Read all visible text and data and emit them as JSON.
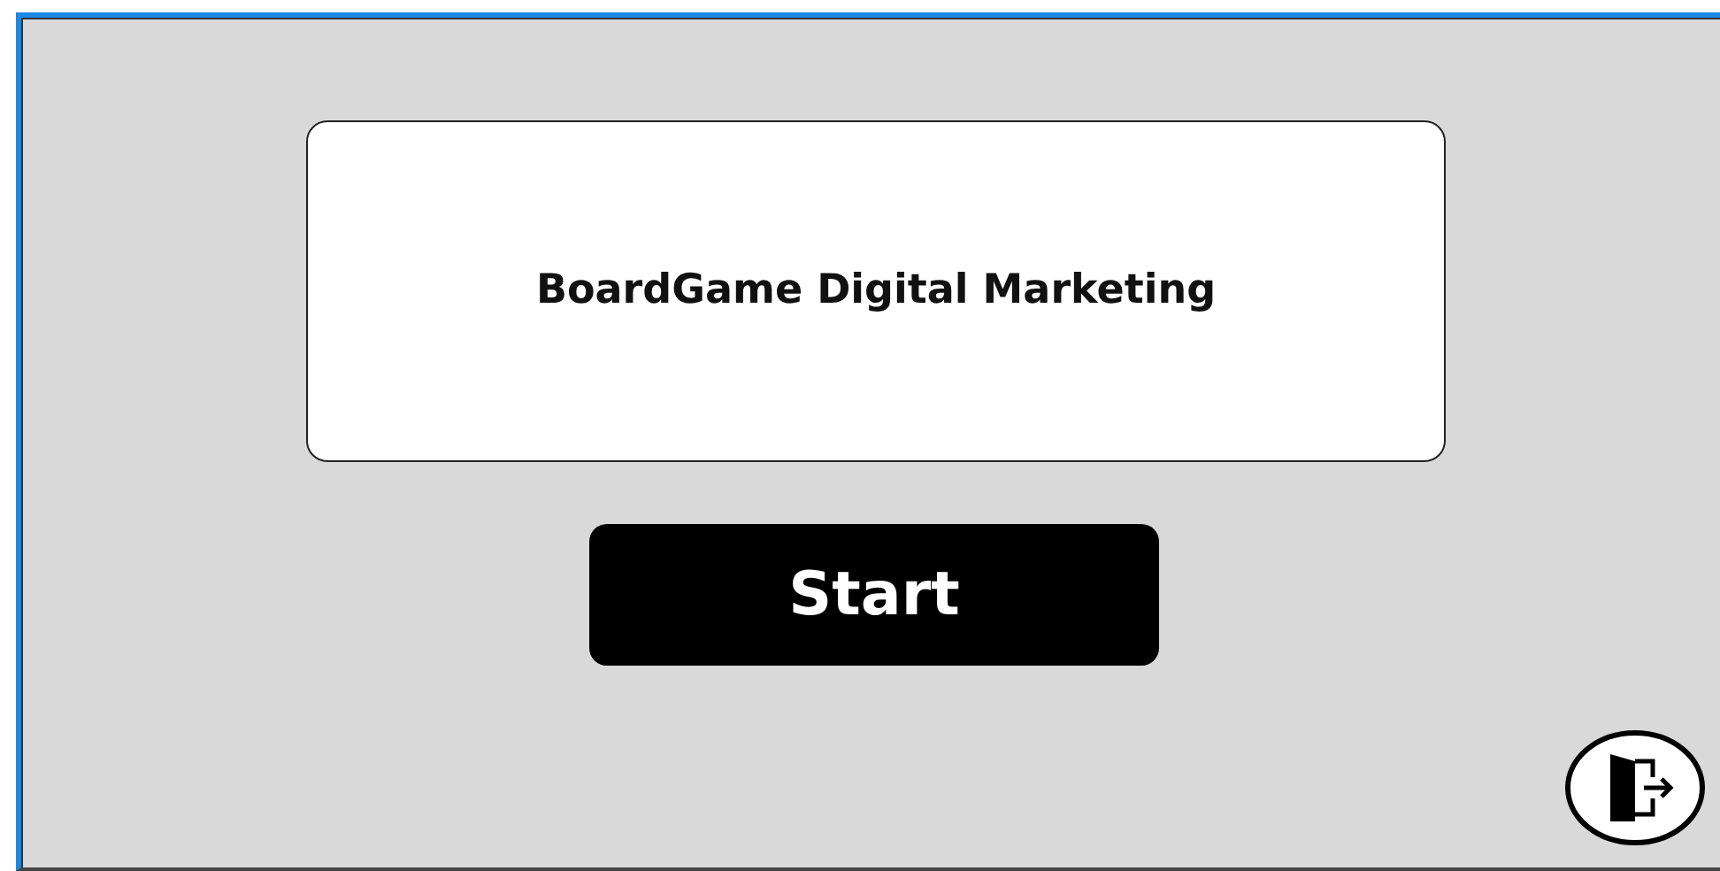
{
  "title_card": {
    "text": "BoardGame Digital Marketing"
  },
  "start_button": {
    "label": "Start"
  }
}
